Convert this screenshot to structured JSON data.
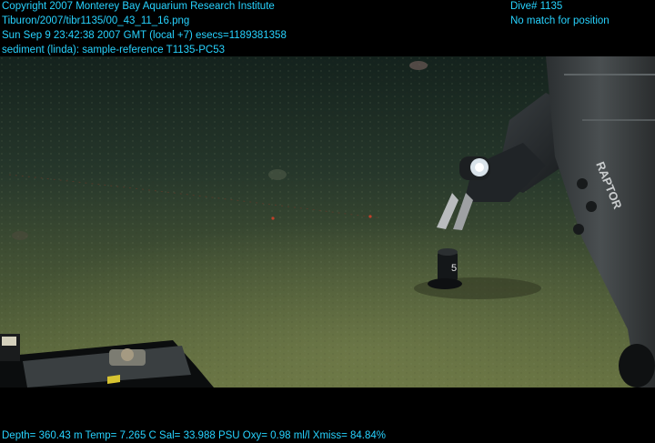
{
  "header": {
    "left_lines": [
      "Copyright 2007 Monterey Bay Aquarium Research Institute",
      "Tiburon/2007/tibr1135/00_43_11_16.png",
      "Sun Sep  9 23:42:38 2007 GMT (local +7)  esecs=1189381358",
      "sediment (linda): sample-reference T1135-PC53"
    ],
    "right_lines": [
      "Dive# 1135",
      "No match for position"
    ]
  },
  "scene": {
    "marker_label": "5",
    "vehicle_label": "RAPTOR"
  },
  "footer": {
    "telemetry": "Depth= 360.43 m  Temp= 7.265 C  Sal= 33.988 PSU  Oxy= 0.98 ml/l  Xmiss= 84.84%"
  },
  "colors": {
    "overlay_text": "#27d3ff",
    "water_top": "#16241f",
    "seafloor": "#5f6c3e"
  }
}
